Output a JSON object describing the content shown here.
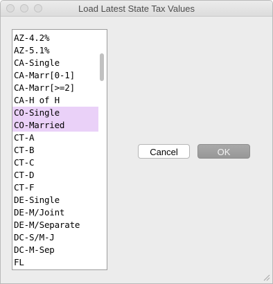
{
  "window": {
    "title": "Load Latest State Tax Values"
  },
  "list": {
    "items": [
      "AZ-4.2%",
      "AZ-5.1%",
      "CA-Single",
      "CA-Marr[0-1]",
      "CA-Marr[>=2]",
      "CA-H of H",
      "CO-Single",
      "CO-Married",
      "CT-A",
      "CT-B",
      "CT-C",
      "CT-D",
      "CT-F",
      "DE-Single",
      "DE-M/Joint",
      "DE-M/Separate",
      "DC-S/M-J",
      "DC-M-Sep",
      "FL"
    ],
    "selected": [
      "CO-Single",
      "CO-Married"
    ],
    "selection_color": "#ead1f8"
  },
  "buttons": {
    "cancel_label": "Cancel",
    "ok_label": "OK"
  },
  "icons": {
    "resize": "resize-grip-icon",
    "window_controls": [
      "close-icon",
      "minimize-icon",
      "zoom-icon"
    ]
  }
}
